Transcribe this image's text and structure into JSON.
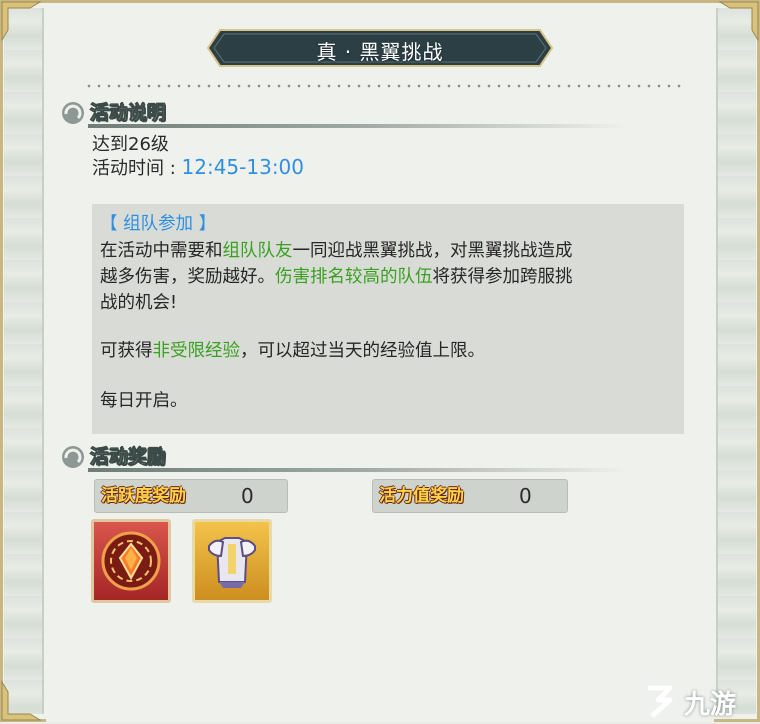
{
  "title": "真 · 黑翼挑战",
  "section_info": {
    "label": "活动说明",
    "level": "达到26级",
    "time_label": "活动时间 : ",
    "time_value": "12:45-13:00"
  },
  "description": {
    "tag": "【 组队参加 】",
    "line1_a": "在活动中需要和",
    "line1_b": "组队队友",
    "line1_c": "一同迎战黑翼挑战，对黑翼挑战造成",
    "line2_a": "越多伤害，奖励越好。",
    "line2_b": "伤害排名较高的队伍",
    "line2_c": "将获得参加跨服挑",
    "line3": "战的机会!",
    "line4_a": "可获得",
    "line4_b": "非受限经验",
    "line4_c": "，可以超过当天的经验值上限。",
    "line5": "每日开启。"
  },
  "section_reward": {
    "label": "活动奖励",
    "activity_label": "活跃度奖励",
    "activity_value": "0",
    "vitality_label": "活力值奖励",
    "vitality_value": "0"
  },
  "items": [
    {
      "icon": "fire-gem-icon",
      "color": "#b83a32"
    },
    {
      "icon": "armor-icon",
      "color": "#e0a93a"
    }
  ],
  "watermark": "九游",
  "colors": {
    "accent_blue": "#2f8fe0",
    "highlight_green": "#3aa021",
    "banner": "#2c3f44",
    "frame_gold": "#c9b783"
  }
}
